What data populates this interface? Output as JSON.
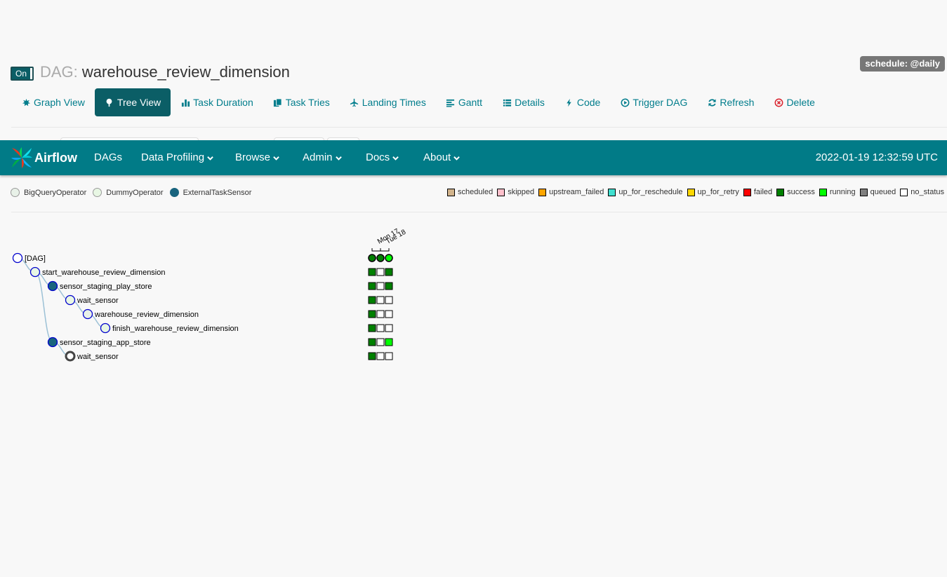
{
  "header": {
    "toggle_label": "On",
    "title_prefix": "DAG:",
    "dag_id": "warehouse_review_dimension",
    "schedule_badge": "schedule: @daily"
  },
  "tabs": [
    {
      "label": "Graph View",
      "icon": "graph-icon"
    },
    {
      "label": "Tree View",
      "icon": "tree-icon",
      "active": true
    },
    {
      "label": "Task Duration",
      "icon": "bar-chart-icon"
    },
    {
      "label": "Task Tries",
      "icon": "duplicate-icon"
    },
    {
      "label": "Landing Times",
      "icon": "plane-icon"
    },
    {
      "label": "Gantt",
      "icon": "align-left-icon"
    },
    {
      "label": "Details",
      "icon": "list-icon"
    },
    {
      "label": "Code",
      "icon": "flash-icon"
    },
    {
      "label": "Trigger DAG",
      "icon": "play-circle-icon"
    },
    {
      "label": "Refresh",
      "icon": "refresh-icon"
    },
    {
      "label": "Delete",
      "icon": "remove-circle-icon"
    }
  ],
  "navbar": {
    "brand": "Airflow",
    "items": [
      "DAGs",
      "Data Profiling",
      "Browse",
      "Admin",
      "Docs",
      "About"
    ],
    "clock": "2022-01-19 12:32:59 UTC"
  },
  "operators": [
    {
      "label": "BigQueryOperator",
      "color": "#e8f1e8"
    },
    {
      "label": "DummyOperator",
      "color": "#e8f7e4"
    },
    {
      "label": "ExternalTaskSensor",
      "color": "#19647e"
    }
  ],
  "states": [
    {
      "label": "scheduled",
      "color": "#d2b48c"
    },
    {
      "label": "skipped",
      "color": "#ffc0cb"
    },
    {
      "label": "upstream_failed",
      "color": "#ffa500"
    },
    {
      "label": "up_for_reschedule",
      "color": "#40e0d0"
    },
    {
      "label": "up_for_retry",
      "color": "#ffd700"
    },
    {
      "label": "failed",
      "color": "#ff0000"
    },
    {
      "label": "success",
      "color": "#008000"
    },
    {
      "label": "running",
      "color": "#00ff00"
    },
    {
      "label": "queued",
      "color": "#808080"
    },
    {
      "label": "no_status",
      "color": "#ffffff"
    }
  ],
  "tree": {
    "date_labels": [
      "Mon 17",
      "Tue 18"
    ],
    "dag_run_states": [
      "success",
      "success",
      "running"
    ],
    "nodes": [
      {
        "label": "[DAG]",
        "depth": 0,
        "operator": "dag",
        "cells": []
      },
      {
        "label": "start_warehouse_review_dimension",
        "depth": 1,
        "operator": "DummyOperator",
        "cells": [
          "success",
          "no_status",
          "success"
        ]
      },
      {
        "label": "sensor_staging_play_store",
        "depth": 2,
        "operator": "ExternalTaskSensor",
        "cells": [
          "success",
          "no_status",
          "success"
        ]
      },
      {
        "label": "wait_sensor",
        "depth": 3,
        "operator": "DummyOperator",
        "cells": [
          "success",
          "no_status",
          "no_status"
        ]
      },
      {
        "label": "warehouse_review_dimension",
        "depth": 4,
        "operator": "BigQueryOperator",
        "cells": [
          "success",
          "no_status",
          "no_status"
        ]
      },
      {
        "label": "finish_warehouse_review_dimension",
        "depth": 5,
        "operator": "DummyOperator",
        "cells": [
          "success",
          "no_status",
          "no_status"
        ]
      },
      {
        "label": "sensor_staging_app_store",
        "depth": 2,
        "operator": "ExternalTaskSensor",
        "cells": [
          "success",
          "no_status",
          "running"
        ]
      },
      {
        "label": "wait_sensor",
        "depth": 3,
        "operator": "DummyOperator",
        "collapsed": true,
        "cells": [
          "success",
          "no_status",
          "no_status"
        ]
      }
    ]
  }
}
